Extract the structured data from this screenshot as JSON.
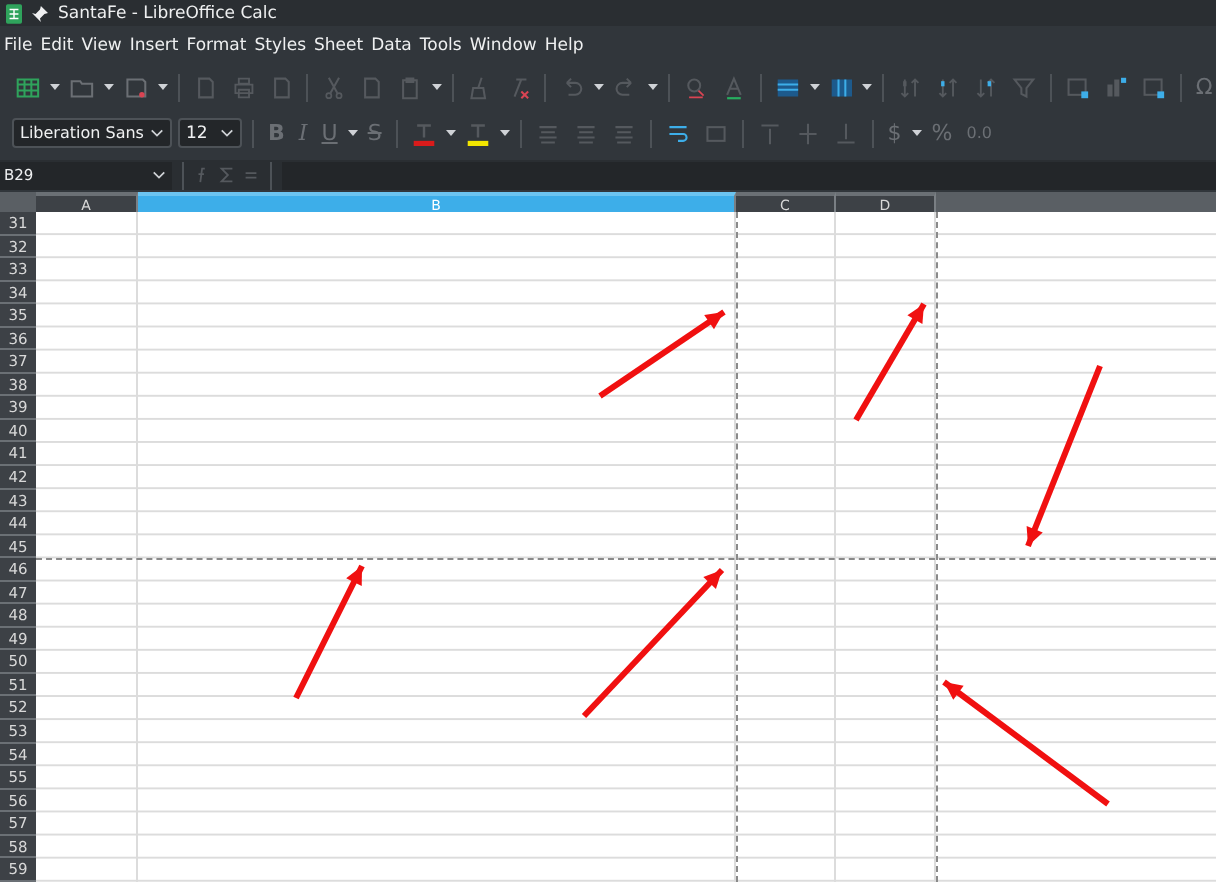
{
  "window": {
    "title": "SantaFe - LibreOffice Calc"
  },
  "menu": [
    "File",
    "Edit",
    "View",
    "Insert",
    "Format",
    "Styles",
    "Sheet",
    "Data",
    "Tools",
    "Window",
    "Help"
  ],
  "toolbar": {
    "special_character": "Ω"
  },
  "format_bar": {
    "font_name": "Liberation Sans",
    "font_size": "12",
    "bold": "B",
    "italic": "I",
    "underline": "U",
    "strikethrough": "S",
    "currency": "$",
    "percent": "%",
    "number": "0.0"
  },
  "formula_bar": {
    "name_box": "B29"
  },
  "columns": [
    {
      "label": "A",
      "selected": false,
      "page_break_after": false
    },
    {
      "label": "B",
      "selected": true,
      "page_break_after": true
    },
    {
      "label": "C",
      "selected": false,
      "page_break_after": false
    },
    {
      "label": "D",
      "selected": false,
      "page_break_after": true
    }
  ],
  "rows": [
    {
      "label": "31",
      "page_break_after": false
    },
    {
      "label": "32",
      "page_break_after": false
    },
    {
      "label": "33",
      "page_break_after": false
    },
    {
      "label": "34",
      "page_break_after": false
    },
    {
      "label": "35",
      "page_break_after": false
    },
    {
      "label": "36",
      "page_break_after": false
    },
    {
      "label": "37",
      "page_break_after": false
    },
    {
      "label": "38",
      "page_break_after": false
    },
    {
      "label": "39",
      "page_break_after": false
    },
    {
      "label": "40",
      "page_break_after": false
    },
    {
      "label": "41",
      "page_break_after": false
    },
    {
      "label": "42",
      "page_break_after": false
    },
    {
      "label": "43",
      "page_break_after": false
    },
    {
      "label": "44",
      "page_break_after": false
    },
    {
      "label": "45",
      "page_break_after": true
    },
    {
      "label": "46",
      "page_break_after": false
    },
    {
      "label": "47",
      "page_break_after": false
    },
    {
      "label": "48",
      "page_break_after": false
    },
    {
      "label": "49",
      "page_break_after": false
    },
    {
      "label": "50",
      "page_break_after": false
    },
    {
      "label": "51",
      "page_break_after": false
    },
    {
      "label": "52",
      "page_break_after": false
    },
    {
      "label": "53",
      "page_break_after": false
    },
    {
      "label": "54",
      "page_break_after": false
    },
    {
      "label": "55",
      "page_break_after": false
    },
    {
      "label": "56",
      "page_break_after": false
    },
    {
      "label": "57",
      "page_break_after": false
    },
    {
      "label": "58",
      "page_break_after": false
    },
    {
      "label": "59",
      "page_break_after": false
    }
  ]
}
